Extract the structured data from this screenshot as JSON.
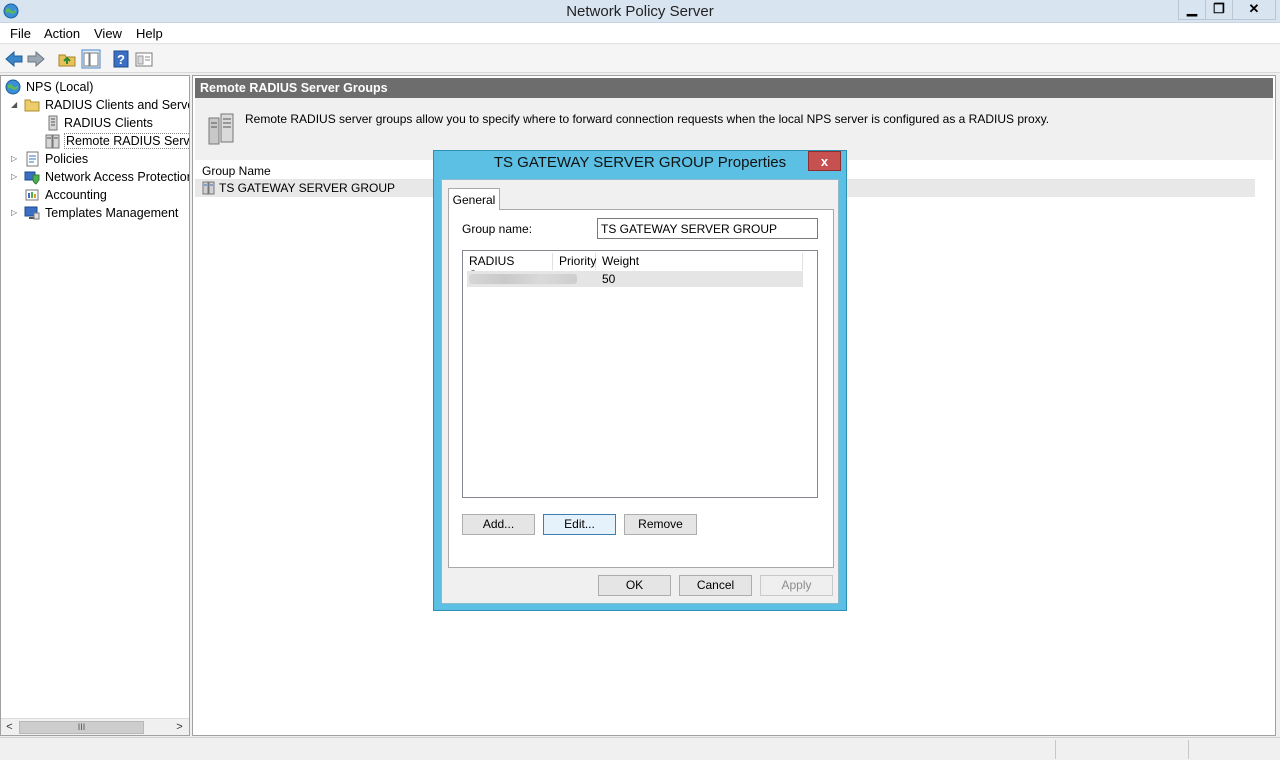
{
  "window": {
    "title": "Network Policy Server",
    "min_glyph": "▁",
    "max_glyph": "❐",
    "close_glyph": "✕"
  },
  "menu": [
    "File",
    "Action",
    "View",
    "Help"
  ],
  "toolbar": {
    "icons": [
      "back-icon",
      "forward-icon",
      "up-folder-icon",
      "show-hide-tree-icon",
      "help-icon",
      "properties-icon"
    ]
  },
  "tree": {
    "items": [
      {
        "label": "NPS (Local)"
      },
      {
        "label": "RADIUS Clients and Servers"
      },
      {
        "label": "RADIUS Clients"
      },
      {
        "label": "Remote RADIUS Server"
      },
      {
        "label": "Policies"
      },
      {
        "label": "Network Access Protection"
      },
      {
        "label": "Accounting"
      },
      {
        "label": "Templates Management"
      }
    ],
    "scroll_left": "<",
    "scroll_right": ">",
    "scroll_thumb": "III"
  },
  "main": {
    "header": "Remote RADIUS Server Groups",
    "description": "Remote RADIUS server groups allow you to specify where to forward connection requests when the local NPS server is configured as a RADIUS proxy.",
    "column_header": "Group Name",
    "rows": [
      {
        "name": "TS GATEWAY SERVER GROUP"
      }
    ]
  },
  "dialog": {
    "title": "TS GATEWAY SERVER GROUP Properties",
    "close_glyph": "x",
    "tab": "General",
    "group_name_label": "Group name:",
    "group_name_value": "TS GATEWAY SERVER GROUP",
    "list_columns": [
      "RADIUS Server",
      "Priority",
      "Weight"
    ],
    "list_rows": [
      {
        "server": "",
        "priority": "",
        "weight": "50"
      }
    ],
    "add_button": "Add...",
    "edit_button": "Edit...",
    "remove_button": "Remove",
    "ok_button": "OK",
    "cancel_button": "Cancel",
    "apply_button": "Apply"
  },
  "colors": {
    "dialog_frame": "#5bc0e3",
    "close_red": "#c75050",
    "header_gray": "#6d6d6d"
  }
}
